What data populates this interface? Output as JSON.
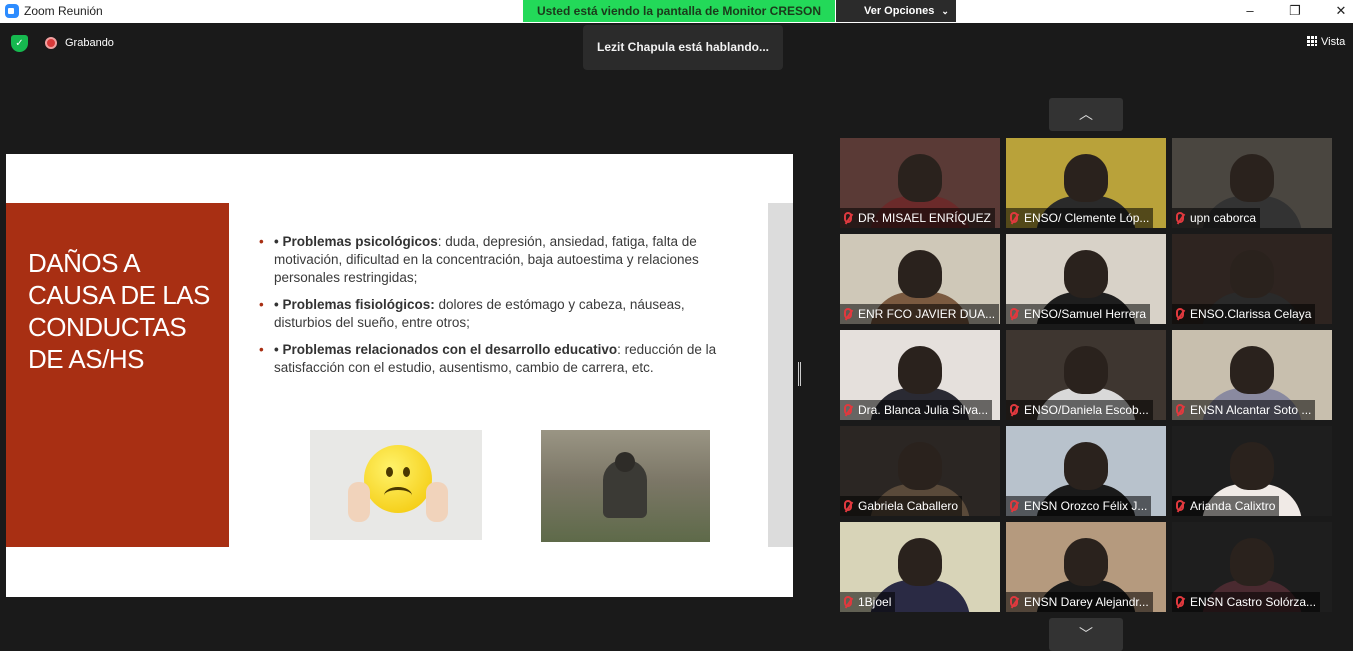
{
  "window": {
    "title": "Zoom Reunión",
    "minimize": "–",
    "maximize": "❐",
    "close": "✕"
  },
  "share": {
    "banner": "Usted está viendo la pantalla de Monitor CRESON",
    "options": "Ver Opciones"
  },
  "toolbar": {
    "recording": "Grabando",
    "view": "Vista"
  },
  "speaking": "Lezit Chapula está hablando...",
  "slide": {
    "title": "DAÑOS A CAUSA DE LAS CONDUCTAS DE AS/HS",
    "bullets": [
      {
        "heading": "• Problemas psicológicos",
        "text": ": duda, depresión, ansiedad, fatiga, falta de motivación, dificultad en la concentración, baja autoestima y relaciones personales restringidas;"
      },
      {
        "heading": "• Problemas fisiológicos:",
        "text": " dolores de estómago y cabeza, náuseas, disturbios del sueño, entre otros;"
      },
      {
        "heading": "• Problemas relacionados con el desarrollo educativo",
        "text": ": reducción de la satisfacción con el estudio, ausentismo, cambio de carrera, etc."
      }
    ]
  },
  "gallery": {
    "scroll_up": "︿",
    "scroll_down": "﹀",
    "participants": [
      {
        "name": "DR. MISAEL ENRÍQUEZ",
        "bg": "#5a3a36",
        "body": "#6b2a2a"
      },
      {
        "name": "ENSO/ Clemente Lóp...",
        "bg": "#b9a23a",
        "body": "#2a2a2a"
      },
      {
        "name": "upn caborca",
        "bg": "#4a4640",
        "body": "#333"
      },
      {
        "name": "ENR FCO JAVIER DUA...",
        "bg": "#cfc8b8",
        "body": "#7b5a40"
      },
      {
        "name": "ENSO/Samuel Herrera",
        "bg": "#d8d2c8",
        "body": "#1e1e1e"
      },
      {
        "name": "ENSO.Clarissa Celaya",
        "bg": "#2e2420",
        "body": "#2a2a2a"
      },
      {
        "name": "Dra. Blanca Julia Silva...",
        "bg": "#e5e0dc",
        "body": "#2a2a33"
      },
      {
        "name": "ENSO/Daniela Escob...",
        "bg": "#3e3630",
        "body": "#d9d9d9"
      },
      {
        "name": "ENSN Alcantar Soto ...",
        "bg": "#c8bfae",
        "body": "#8a8aa0"
      },
      {
        "name": "Gabriela Caballero",
        "bg": "#2b2623",
        "body": "#5a4a3a"
      },
      {
        "name": "ENSN Orozco Félix J...",
        "bg": "#b8c2cc",
        "body": "#1a1a1a"
      },
      {
        "name": "Arianda Calixtro",
        "bg": "#1e1e1e",
        "body": "#f0eae6"
      },
      {
        "name": "1Bjoel",
        "bg": "#d8d4b8",
        "body": "#2a2a44"
      },
      {
        "name": "ENSN Darey Alejandr...",
        "bg": "#b59a7e",
        "body": "#1a1a1a"
      },
      {
        "name": "ENSN Castro Solórza...",
        "bg": "#1e1e1e",
        "body": "#4a2a30"
      }
    ]
  }
}
